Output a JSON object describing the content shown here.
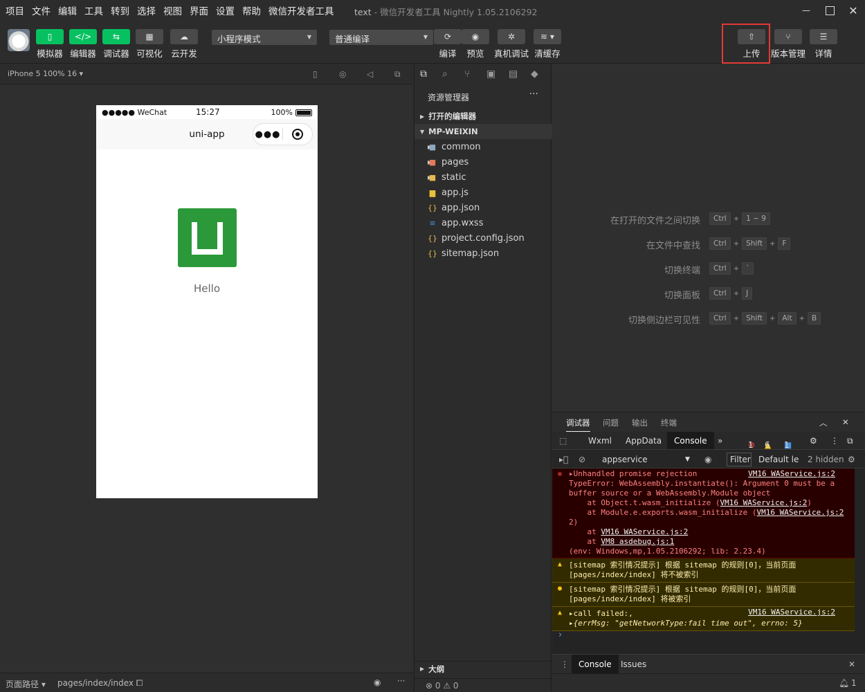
{
  "menu": [
    "项目",
    "文件",
    "编辑",
    "工具",
    "转到",
    "选择",
    "视图",
    "界面",
    "设置",
    "帮助",
    "微信开发者工具"
  ],
  "window": {
    "project": "text",
    "title": "微信开发者工具 Nightly 1.05.2106292"
  },
  "toolbar": {
    "simulator": "模拟器",
    "editor": "编辑器",
    "debugger": "调试器",
    "visual": "可视化",
    "cloud": "云开发",
    "mode": "小程序模式",
    "compile_mode": "普通编译",
    "compile": "编译",
    "preview": "预览",
    "real_debug": "真机调试",
    "clear_cache": "清缓存",
    "upload": "上传",
    "version": "版本管理",
    "details": "详情"
  },
  "simulator": {
    "device": "iPhone 5 100% 16 ▾",
    "signal": "●●●●● WeChat",
    "time": "15:27",
    "battery": "100%",
    "nav_title": "uni-app",
    "hello": "Hello"
  },
  "footer": {
    "page_path_label": "页面路径 ▾",
    "page_path": "pages/index/index"
  },
  "explorer": {
    "title": "资源管理器",
    "open_editors": "打开的编辑器",
    "project": "MP-WEIXIN",
    "items": [
      "common",
      "pages",
      "static",
      "app.js",
      "app.json",
      "app.wxss",
      "project.config.json",
      "sitemap.json"
    ],
    "outline": "大纲",
    "status": "⊗ 0 ⚠ 0"
  },
  "shortcuts": [
    {
      "desc": "在打开的文件之间切换",
      "keys": [
        "Ctrl",
        "+",
        "1 ~ 9"
      ]
    },
    {
      "desc": "在文件中查找",
      "keys": [
        "Ctrl",
        "+",
        "Shift",
        "+",
        "F"
      ]
    },
    {
      "desc": "切换终端",
      "keys": [
        "Ctrl",
        "+",
        "`"
      ]
    },
    {
      "desc": "切换面板",
      "keys": [
        "Ctrl",
        "+",
        "J"
      ]
    },
    {
      "desc": "切换侧边栏可见性",
      "keys": [
        "Ctrl",
        "+",
        "Shift",
        "+",
        "Alt",
        "+",
        "B"
      ]
    }
  ],
  "debug": {
    "tabs": [
      "调试器",
      "问题",
      "输出",
      "终端"
    ],
    "console_tabs": [
      "Wxml",
      "AppData",
      "Console"
    ],
    "errors": "1",
    "warnings": "6",
    "infos": "1",
    "context": "appservice",
    "filter": "Filter",
    "levels": "Default le",
    "hidden": "2 hidden",
    "log": {
      "err_title": "▸Unhandled promise rejection",
      "src1": "VM16 WAService.js:2",
      "err_l2": "TypeError: WebAssembly.instantiate(): Argument 0 must be a",
      "err_l3": "buffer source or a WebAssembly.Module object",
      "err_l4": "    at Object.t.wasm_initialize (",
      "err_l5": "    at Module.e.exports.wasm_initialize (",
      "err_l6": "2)",
      "err_l7": "    at ",
      "err_l8": "    at ",
      "src_vm8": "VM8 asdebug.js:1",
      "err_l9": "(env: Windows,mp,1.05.2106292; lib: 2.23.4)",
      "w1_a": "[sitemap 索引情况提示] 根据 sitemap 的规则[0]，当前页面",
      "w1_b": "[pages/index/index] 将不被索引",
      "w2_a": "[sitemap 索引情况提示] 根据 sitemap 的规则[0]，当前页面",
      "w2_b": "[pages/index/index] 将被索引",
      "w3_a": "▸call failed:,",
      "w3_b": "▸{errMsg: \"getNetworkType:fail time out\", errno: 5}"
    },
    "drawer_tabs": [
      "Console",
      "Issues"
    ]
  }
}
